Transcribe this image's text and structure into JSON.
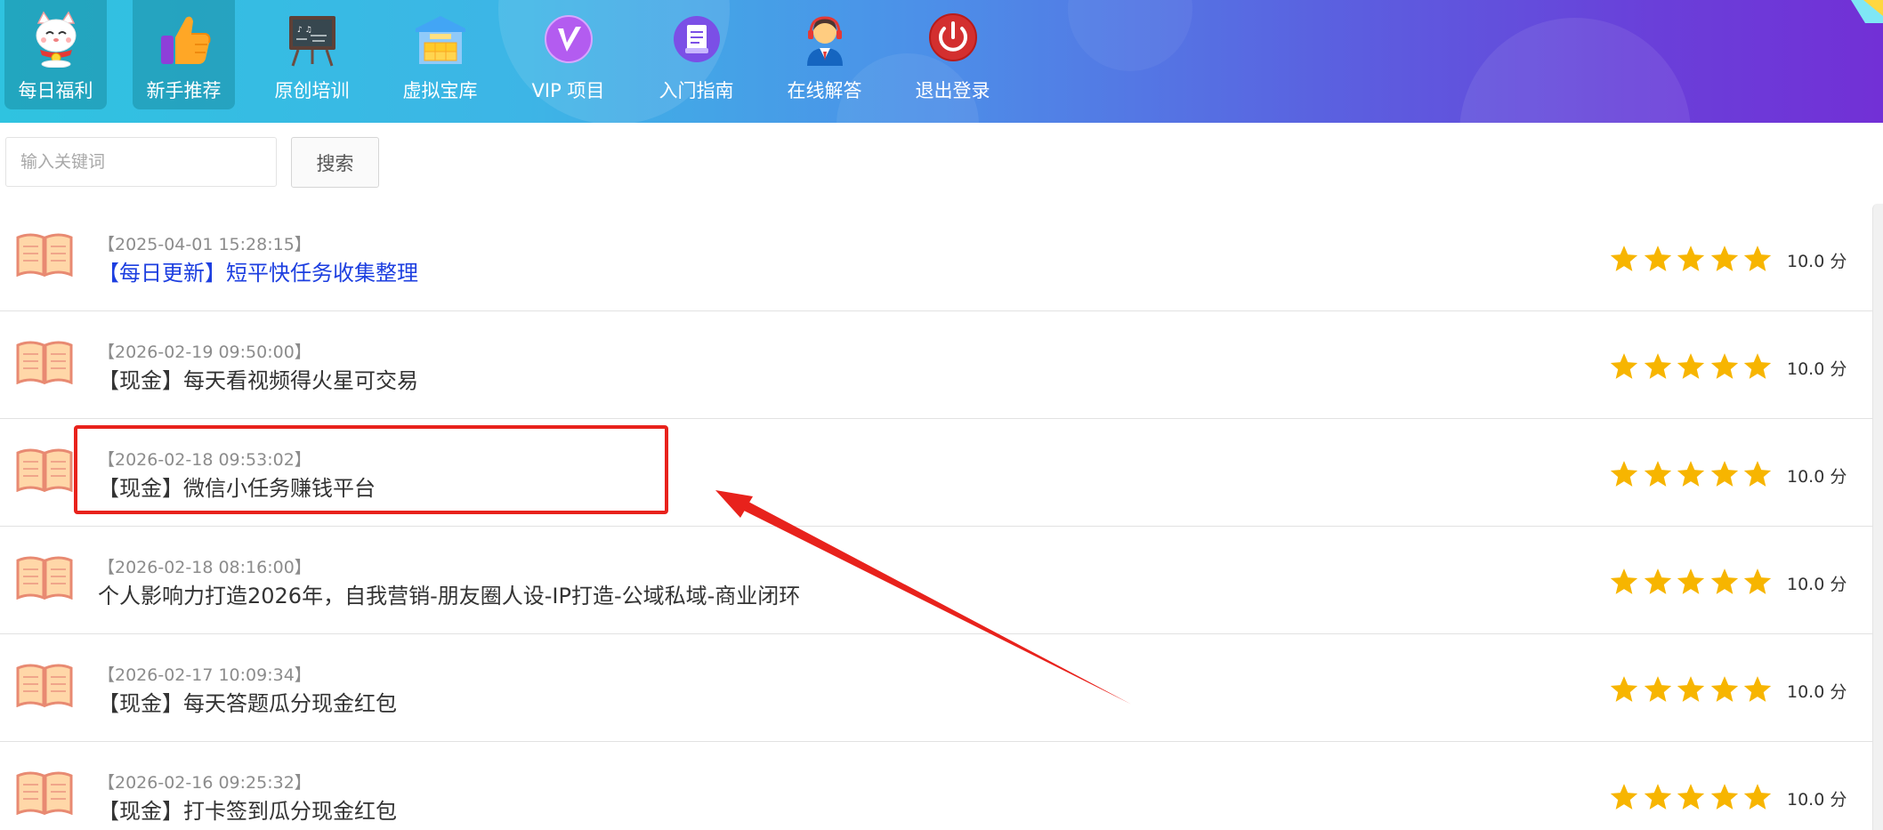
{
  "nav": {
    "items": [
      {
        "label": "每日福利",
        "icon": "lucky-cat-icon",
        "active": true
      },
      {
        "label": "新手推荐",
        "icon": "thumbs-up-icon",
        "active": true
      },
      {
        "label": "原创培训",
        "icon": "chalkboard-icon",
        "active": false
      },
      {
        "label": "虚拟宝库",
        "icon": "warehouse-icon",
        "active": false
      },
      {
        "label": "VIP 项目",
        "icon": "vip-icon",
        "active": false
      },
      {
        "label": "入门指南",
        "icon": "document-icon",
        "active": false
      },
      {
        "label": "在线解答",
        "icon": "support-agent-icon",
        "active": false
      },
      {
        "label": "退出登录",
        "icon": "power-icon",
        "active": false
      }
    ]
  },
  "search": {
    "placeholder": "输入关键词",
    "value": "",
    "button_label": "搜索"
  },
  "articles": [
    {
      "date": "【2025-04-01 15:28:15】",
      "title": "【每日更新】短平快任务收集整理",
      "rating": 5,
      "score": "10.0 分",
      "highlight": true
    },
    {
      "date": "【2026-02-19 09:50:00】",
      "title": "【现金】每天看视频得火星可交易",
      "rating": 5,
      "score": "10.0 分",
      "highlight": false
    },
    {
      "date": "【2026-02-18 09:53:02】",
      "title": "【现金】微信小任务赚钱平台",
      "rating": 5,
      "score": "10.0 分",
      "highlight": false
    },
    {
      "date": "【2026-02-18 08:16:00】",
      "title": "个人影响力打造2026年，自我营销-朋友圈人设-IP打造-公域私域-商业闭环",
      "rating": 5,
      "score": "10.0 分",
      "highlight": false
    },
    {
      "date": "【2026-02-17 10:09:34】",
      "title": "【现金】每天答题瓜分现金红包",
      "rating": 5,
      "score": "10.0 分",
      "highlight": false
    },
    {
      "date": "【2026-02-16 09:25:32】",
      "title": "【现金】打卡签到瓜分现金红包",
      "rating": 5,
      "score": "10.0 分",
      "highlight": false
    }
  ],
  "colors": {
    "header_start": "#2fc3e0",
    "header_end": "#7230d6",
    "link_blue": "#1d3fe0",
    "star": "#f7b500",
    "annotation_red": "#e8221c"
  }
}
